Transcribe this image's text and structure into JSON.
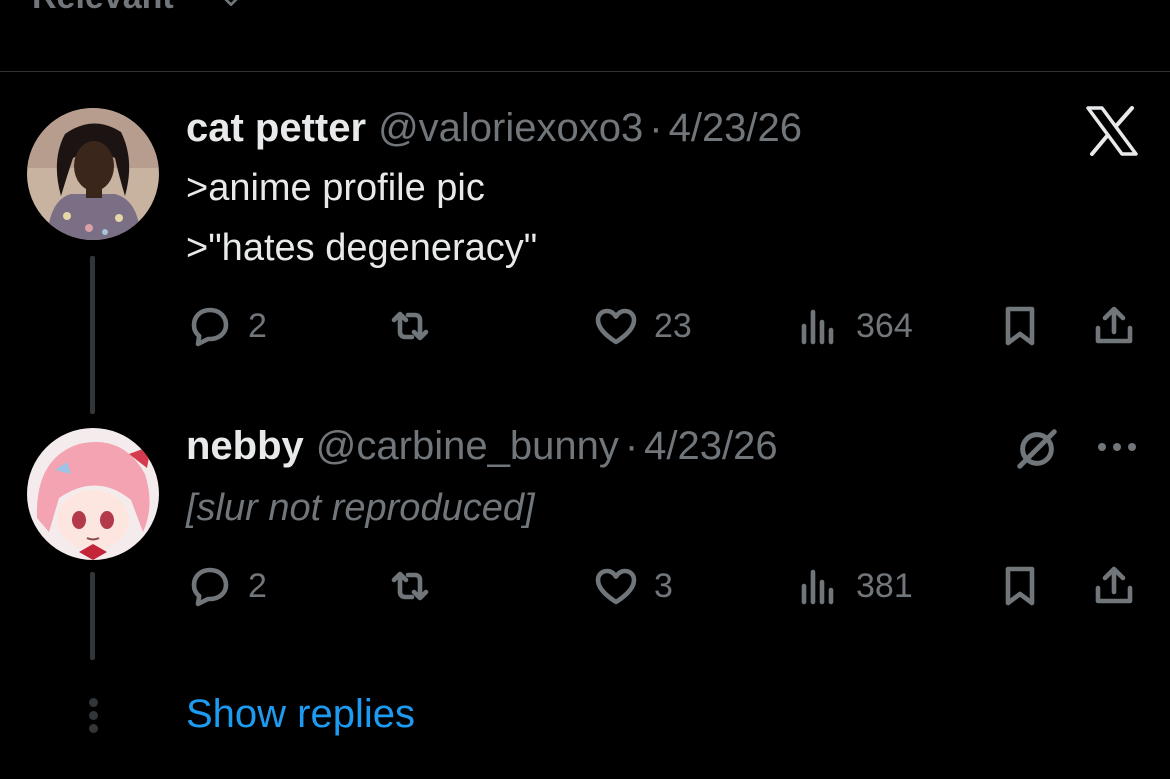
{
  "sort": {
    "label": "Relevant"
  },
  "replies": [
    {
      "display_name": "cat petter",
      "handle": "@valoriexoxo3",
      "separator": "·",
      "date": "4/23/26",
      "lines": [
        ">anime profile pic",
        ">\"hates degeneracy\""
      ],
      "stats": {
        "replies": "2",
        "likes": "23",
        "views": "364"
      },
      "corner_icon": "x-logo-icon"
    },
    {
      "display_name": "nebby",
      "handle": "@carbine_bunny",
      "separator": "·",
      "date": "4/23/26",
      "body_note": "[slur not reproduced]",
      "stats": {
        "replies": "2",
        "likes": "3",
        "views": "381"
      },
      "corner_icons": [
        "grok-icon",
        "more-icon"
      ]
    }
  ],
  "show_replies": "Show replies",
  "colors": {
    "background": "#000000",
    "text": "#e7e9ea",
    "muted": "#71767b",
    "accent": "#1d9bf0",
    "divider": "#2f3336"
  }
}
